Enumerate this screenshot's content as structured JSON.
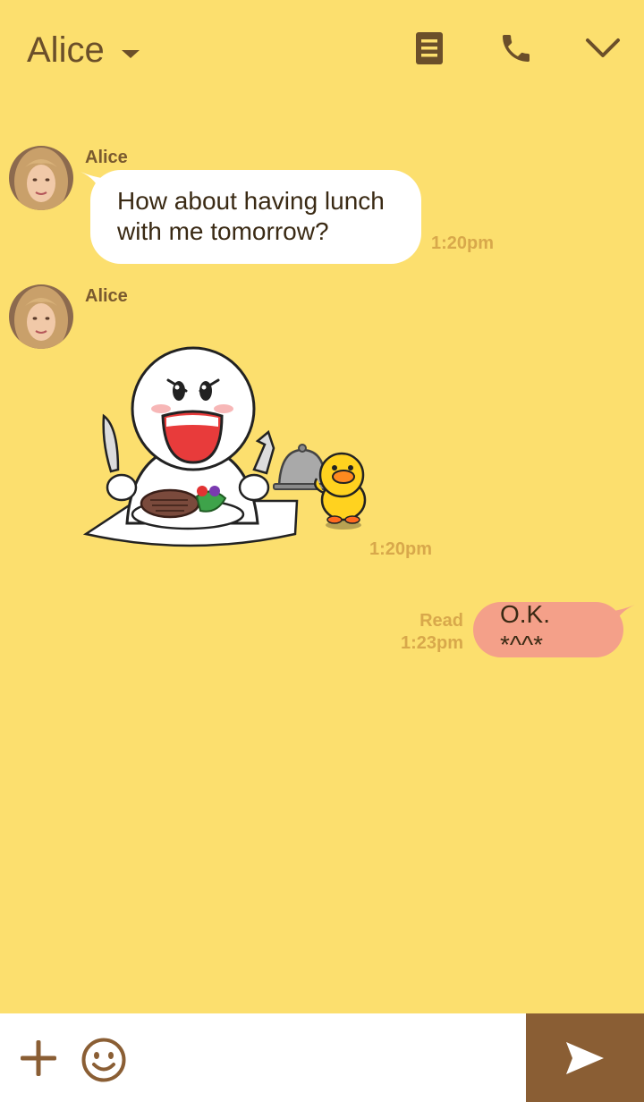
{
  "header": {
    "title": "Alice",
    "caret_icon": "caret-down-icon",
    "notes_icon": "note-icon",
    "call_icon": "phone-icon",
    "collapse_icon": "chevron-down-icon"
  },
  "messages": [
    {
      "sender": "Alice",
      "type": "text",
      "text_line1": "How about having lunch",
      "text_line2": "with me tomorrow?",
      "time": "1:20pm"
    },
    {
      "sender": "Alice",
      "type": "sticker",
      "sticker": "moon-eating-steak-with-duck-waiter-sticker",
      "time": "1:20pm"
    },
    {
      "sender": "me",
      "type": "text",
      "text": "O.K. *^^*",
      "status": "Read",
      "time": "1:23pm"
    }
  ],
  "input_bar": {
    "placeholder": "",
    "add_icon": "plus-icon",
    "emoji_icon": "smiley-icon",
    "send_icon": "send-arrow-icon"
  },
  "colors": {
    "background": "#fcdf6e",
    "accent_brown": "#8a5e34",
    "incoming_bubble": "#ffffff",
    "outgoing_bubble": "#f4a089",
    "timestamp": "#d8a84b"
  }
}
